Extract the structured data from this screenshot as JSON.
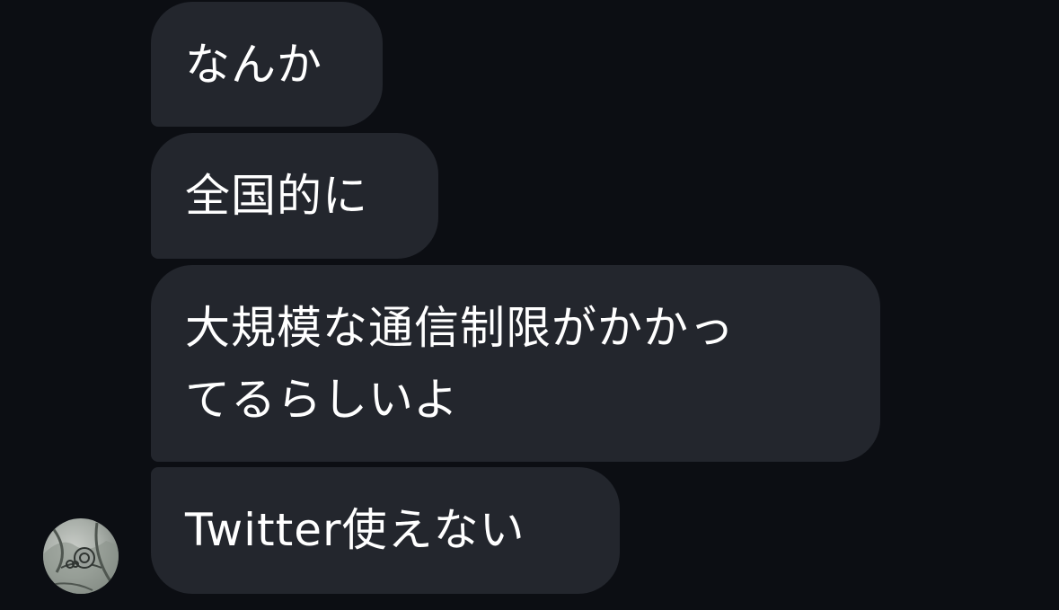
{
  "messages": [
    {
      "text": "なんか"
    },
    {
      "text": "全国的に"
    },
    {
      "lines": [
        "大規模な通信制限がかかっ",
        "てるらしいよ"
      ]
    },
    {
      "text": "Twitter使えない"
    }
  ],
  "colors": {
    "background": "#0c0e13",
    "bubble": "#23262d",
    "text": "#ffffff"
  },
  "icons": {
    "avatar": "sender-avatar-photo"
  }
}
